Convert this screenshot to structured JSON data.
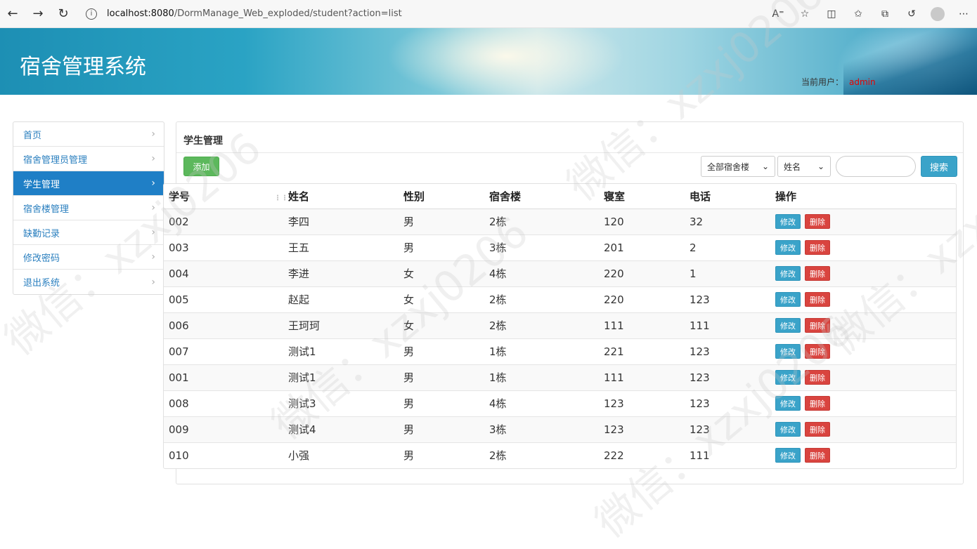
{
  "browser": {
    "url_host": "localhost:8080",
    "url_path": "/DormManage_Web_exploded/student?action=list"
  },
  "header": {
    "title": "宿舍管理系统",
    "current_user_label": "当前用户：",
    "current_user": "admin"
  },
  "sidebar": {
    "items": [
      {
        "label": "首页",
        "active": false
      },
      {
        "label": "宿舍管理员管理",
        "active": false
      },
      {
        "label": "学生管理",
        "active": true
      },
      {
        "label": "宿舍楼管理",
        "active": false
      },
      {
        "label": "缺勤记录",
        "active": false
      },
      {
        "label": "修改密码",
        "active": false
      },
      {
        "label": "退出系统",
        "active": false
      }
    ]
  },
  "main": {
    "title": "学生管理",
    "add_label": "添加",
    "building_select": "全部宿舍楼",
    "field_select": "姓名",
    "search_value": "",
    "search_label": "搜索",
    "columns": [
      "学号",
      "姓名",
      "性别",
      "宿舍楼",
      "寝室",
      "电话",
      "操作"
    ],
    "edit_label": "修改",
    "delete_label": "删除",
    "rows": [
      [
        "002",
        "李四",
        "男",
        "2栋",
        "120",
        "32"
      ],
      [
        "003",
        "王五",
        "男",
        "3栋",
        "201",
        "2"
      ],
      [
        "004",
        "李进",
        "女",
        "4栋",
        "220",
        "1"
      ],
      [
        "005",
        "赵起",
        "女",
        "2栋",
        "220",
        "123"
      ],
      [
        "006",
        "王珂珂",
        "女",
        "2栋",
        "111",
        "111"
      ],
      [
        "007",
        "测试1",
        "男",
        "1栋",
        "221",
        "123"
      ],
      [
        "001",
        "测试1",
        "男",
        "1栋",
        "111",
        "123"
      ],
      [
        "008",
        "测试3",
        "男",
        "4栋",
        "123",
        "123"
      ],
      [
        "009",
        "测试4",
        "男",
        "3栋",
        "123",
        "123"
      ],
      [
        "010",
        "小强",
        "男",
        "2栋",
        "222",
        "111"
      ]
    ]
  },
  "watermark": "微信：xzxj0206"
}
